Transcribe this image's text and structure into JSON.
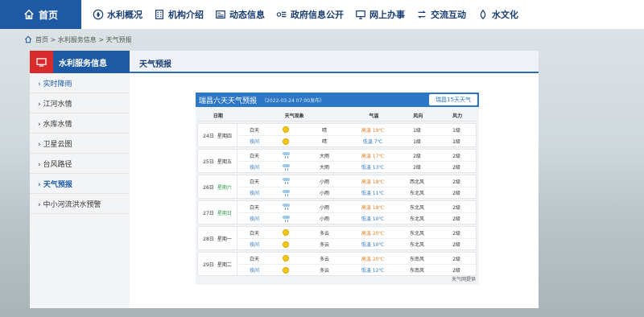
{
  "nav": {
    "home": "首页",
    "items": [
      "水利概况",
      "机构介绍",
      "动态信息",
      "政府信息公开",
      "网上办事",
      "交流互动",
      "水文化"
    ]
  },
  "breadcrumb": "首页 > 水利服务信息 > 天气预报",
  "sidebar": {
    "title": "水利服务信息",
    "items": [
      "› 实时降雨",
      "› 江河水情",
      "› 水库水情",
      "› 卫星云图",
      "› 台风路径",
      "› 天气预报",
      "› 中小河流洪水预警"
    ]
  },
  "content_title": "天气预报",
  "weather": {
    "title": "瑞昌六天天气预报",
    "published": "（2022-03-24 07:00发布）",
    "btn15": "瑞昌15天天气",
    "headers": [
      "日期",
      "天气现象",
      "气温",
      "风向",
      "风力"
    ],
    "source": "天气网提供",
    "days": [
      {
        "date": "24日",
        "week": "星期四",
        "green": false,
        "day": {
          "p": "白天",
          "icon": "sun",
          "ph": "晴",
          "tl": "高温",
          "t": "19℃",
          "dir": "1级",
          "pow": "1级"
        },
        "night": {
          "p": "夜间",
          "icon": "sun",
          "ph": "晴",
          "tl": "低温",
          "t": "7℃",
          "dir": "1级",
          "pow": "1级"
        }
      },
      {
        "date": "25日",
        "week": "星期五",
        "green": false,
        "day": {
          "p": "白天",
          "icon": "rain",
          "ph": "大雨",
          "tl": "高温",
          "t": "17℃",
          "dir": "2级",
          "pow": "2级"
        },
        "night": {
          "p": "夜间",
          "icon": "rain",
          "ph": "大雨",
          "tl": "低温",
          "t": "13℃",
          "dir": "2级",
          "pow": "2级"
        }
      },
      {
        "date": "26日",
        "week": "星期六",
        "green": true,
        "day": {
          "p": "白天",
          "icon": "rain",
          "ph": "小雨",
          "tl": "高温",
          "t": "18℃",
          "dir": "西北风",
          "pow": "2级"
        },
        "night": {
          "p": "夜间",
          "icon": "rain",
          "ph": "小雨",
          "tl": "低温",
          "t": "11℃",
          "dir": "东北风",
          "pow": "2级"
        }
      },
      {
        "date": "27日",
        "week": "星期日",
        "green": true,
        "day": {
          "p": "白天",
          "icon": "rain",
          "ph": "小雨",
          "tl": "高温",
          "t": "18℃",
          "dir": "东北风",
          "pow": "2级"
        },
        "night": {
          "p": "夜间",
          "icon": "rain",
          "ph": "小雨",
          "tl": "低温",
          "t": "10℃",
          "dir": "东北风",
          "pow": "2级"
        }
      },
      {
        "date": "28日",
        "week": "星期一",
        "green": false,
        "day": {
          "p": "白天",
          "icon": "sun",
          "ph": "多云",
          "tl": "高温",
          "t": "20℃",
          "dir": "东北风",
          "pow": "2级"
        },
        "night": {
          "p": "夜间",
          "icon": "sun",
          "ph": "多云",
          "tl": "低温",
          "t": "10℃",
          "dir": "东北风",
          "pow": "2级"
        }
      },
      {
        "date": "29日",
        "week": "星期二",
        "green": false,
        "day": {
          "p": "白天",
          "icon": "sun",
          "ph": "多云",
          "tl": "高温",
          "t": "20℃",
          "dir": "东南风",
          "pow": "2级"
        },
        "night": {
          "p": "夜间",
          "icon": "sun",
          "ph": "多云",
          "tl": "低温",
          "t": "12℃",
          "dir": "东南风",
          "pow": "2级"
        }
      }
    ]
  }
}
